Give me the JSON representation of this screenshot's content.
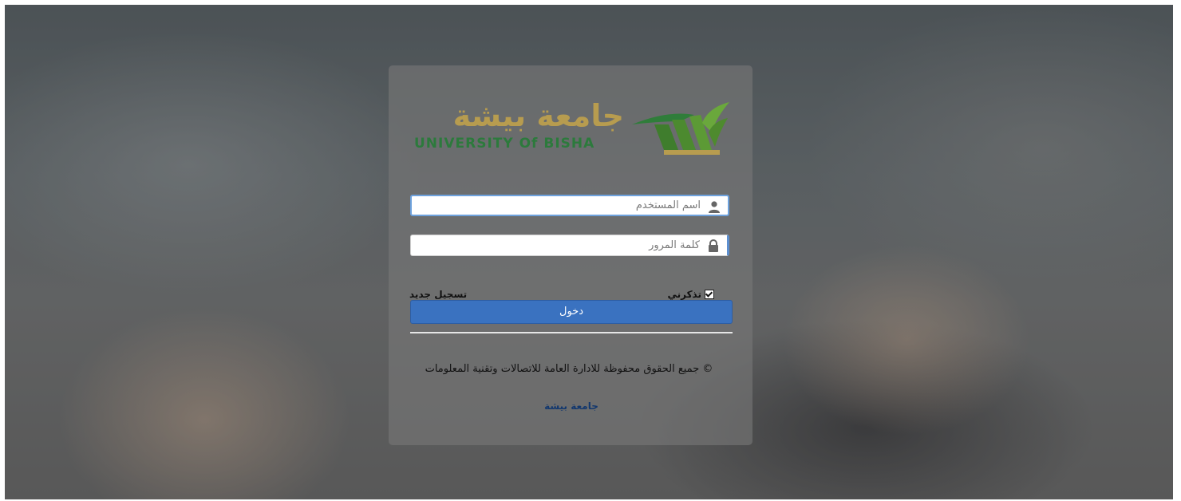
{
  "brand": {
    "name_ar": "جامعة بيشة",
    "name_en": "UNIVERSITY Of BISHA",
    "colors": {
      "gold": "#b79c4f",
      "green": "#2c7a3c"
    }
  },
  "login": {
    "username": {
      "placeholder": "اسم المستخدم",
      "icon": "user-icon"
    },
    "password": {
      "placeholder": "كلمة المرور",
      "icon": "lock-icon"
    },
    "remember_me": {
      "label": "تذكرني",
      "checked": true
    },
    "register_link": "تسجيل جديد",
    "submit_label": "دخول",
    "accent_color": "#3a72c0"
  },
  "footer": {
    "copyright": "© جميع الحقوق محفوظة للادارة العامة للاتصالات وتقنية المعلومات",
    "university_link": "جامعة بيشة"
  }
}
